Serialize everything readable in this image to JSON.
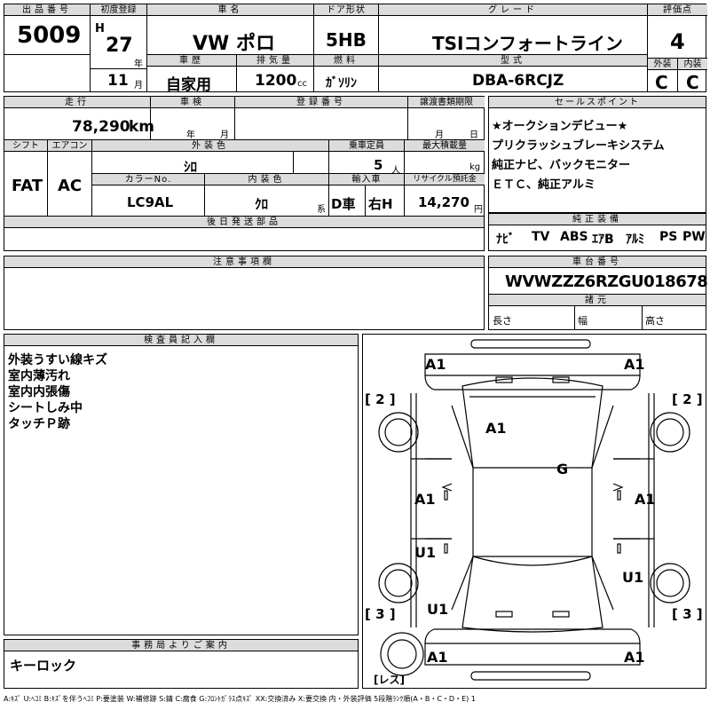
{
  "header": {
    "lot_label": "出品番号",
    "lot": "5009",
    "reg_label": "初度登録",
    "era": "H",
    "year": "27",
    "year_unit": "年",
    "month": "11",
    "month_unit": "月",
    "car_label": "車名",
    "car_name": "VW ポロ",
    "door_label": "ドア形状",
    "door": "5HB",
    "grade_label": "グレード",
    "grade": "TSIコンフォートライン",
    "score_label": "評価点",
    "score": "4",
    "history_label": "車歴",
    "history": "自家用",
    "displacement_label": "排気量",
    "displacement": "1200",
    "displacement_unit": "cc",
    "fuel_label": "燃料",
    "fuel": "ｶﾞｿﾘﾝ",
    "model_label": "型式",
    "model": "DBA-6RCJZ",
    "exterior_label": "外装",
    "exterior_grade": "C",
    "interior_label": "内装",
    "interior_grade": "C"
  },
  "row2": {
    "mileage_label": "走行",
    "mileage": "78,290",
    "mileage_unit": "km",
    "inspection_label": "車検",
    "insp_year_unit": "年",
    "insp_month_unit": "月",
    "plate_label": "登録番号",
    "transfer_label": "譲渡書類期限",
    "transfer_month_unit": "月",
    "transfer_day_unit": "日",
    "shift_label": "シフト",
    "shift": "FAT",
    "ac_label": "エアコン",
    "ac": "AC",
    "ext_color_label": "外装色",
    "ext_color": "ｼﾛ",
    "capacity_label": "乗車定員",
    "capacity": "5",
    "capacity_unit": "人",
    "load_label": "最大積載量",
    "load_unit": "kg",
    "color_no_label": "カラーNo.",
    "color_no": "LC9AL",
    "int_color_label": "内装色",
    "int_color": "ｸﾛ",
    "int_color_suffix": "系",
    "import_label": "輸入車",
    "import_d": "D車",
    "import_r": "右H",
    "recycle_label": "リサイクル預託金",
    "recycle": "14,270",
    "recycle_unit": "円",
    "later_label": "後日発送部品"
  },
  "selling_points": {
    "label": "セールスポイント",
    "lines": [
      "★オークションデビュー★",
      "プリクラッシュブレーキシステム",
      "純正ナビ、バックモニター",
      "ＥＴＣ、純正アルミ"
    ]
  },
  "equipment": {
    "label": "純正装備",
    "items": [
      "ﾅﾋﾞ",
      "TV",
      "ABS",
      "ｴｱB",
      "ｱﾙﾐ",
      "PS",
      "PW"
    ]
  },
  "notes": {
    "label": "注意事項欄"
  },
  "chassis": {
    "label": "車台番号",
    "number": "WVWZZZ6RZGU018678",
    "dims_label": "諸元",
    "length_label": "長さ",
    "width_label": "幅",
    "height_label": "高さ"
  },
  "inspector": {
    "label": "検査員記入欄",
    "lines": [
      "外装うすい線キズ",
      "室内薄汚れ",
      "室内内張傷",
      "シートしみ中",
      "タッチＰ跡"
    ]
  },
  "office": {
    "label": "事務局よりご案内",
    "text": "キーロック"
  },
  "diagram": {
    "marks": [
      "A1",
      "A1",
      "A1",
      "G",
      "A1",
      "A1",
      "U1",
      "U1",
      "U1",
      "A1",
      "A1"
    ],
    "tire_labels": [
      "2",
      "2",
      "3",
      "3"
    ],
    "spare": "レス"
  },
  "legend": "A:ｷｽﾞ U:ﾍｺﾐ B:ｷｽﾞを伴うﾍｺﾐ P:要塗装 W:補修跡 S:錆 C:腐食 G:ﾌﾛﾝﾄｶﾞﾗｽ点ｷｽﾞ XX:交換済み X:要交換  内・外装評価  5段階ﾗﾝｸ順(A・B・C・D・E) 1"
}
